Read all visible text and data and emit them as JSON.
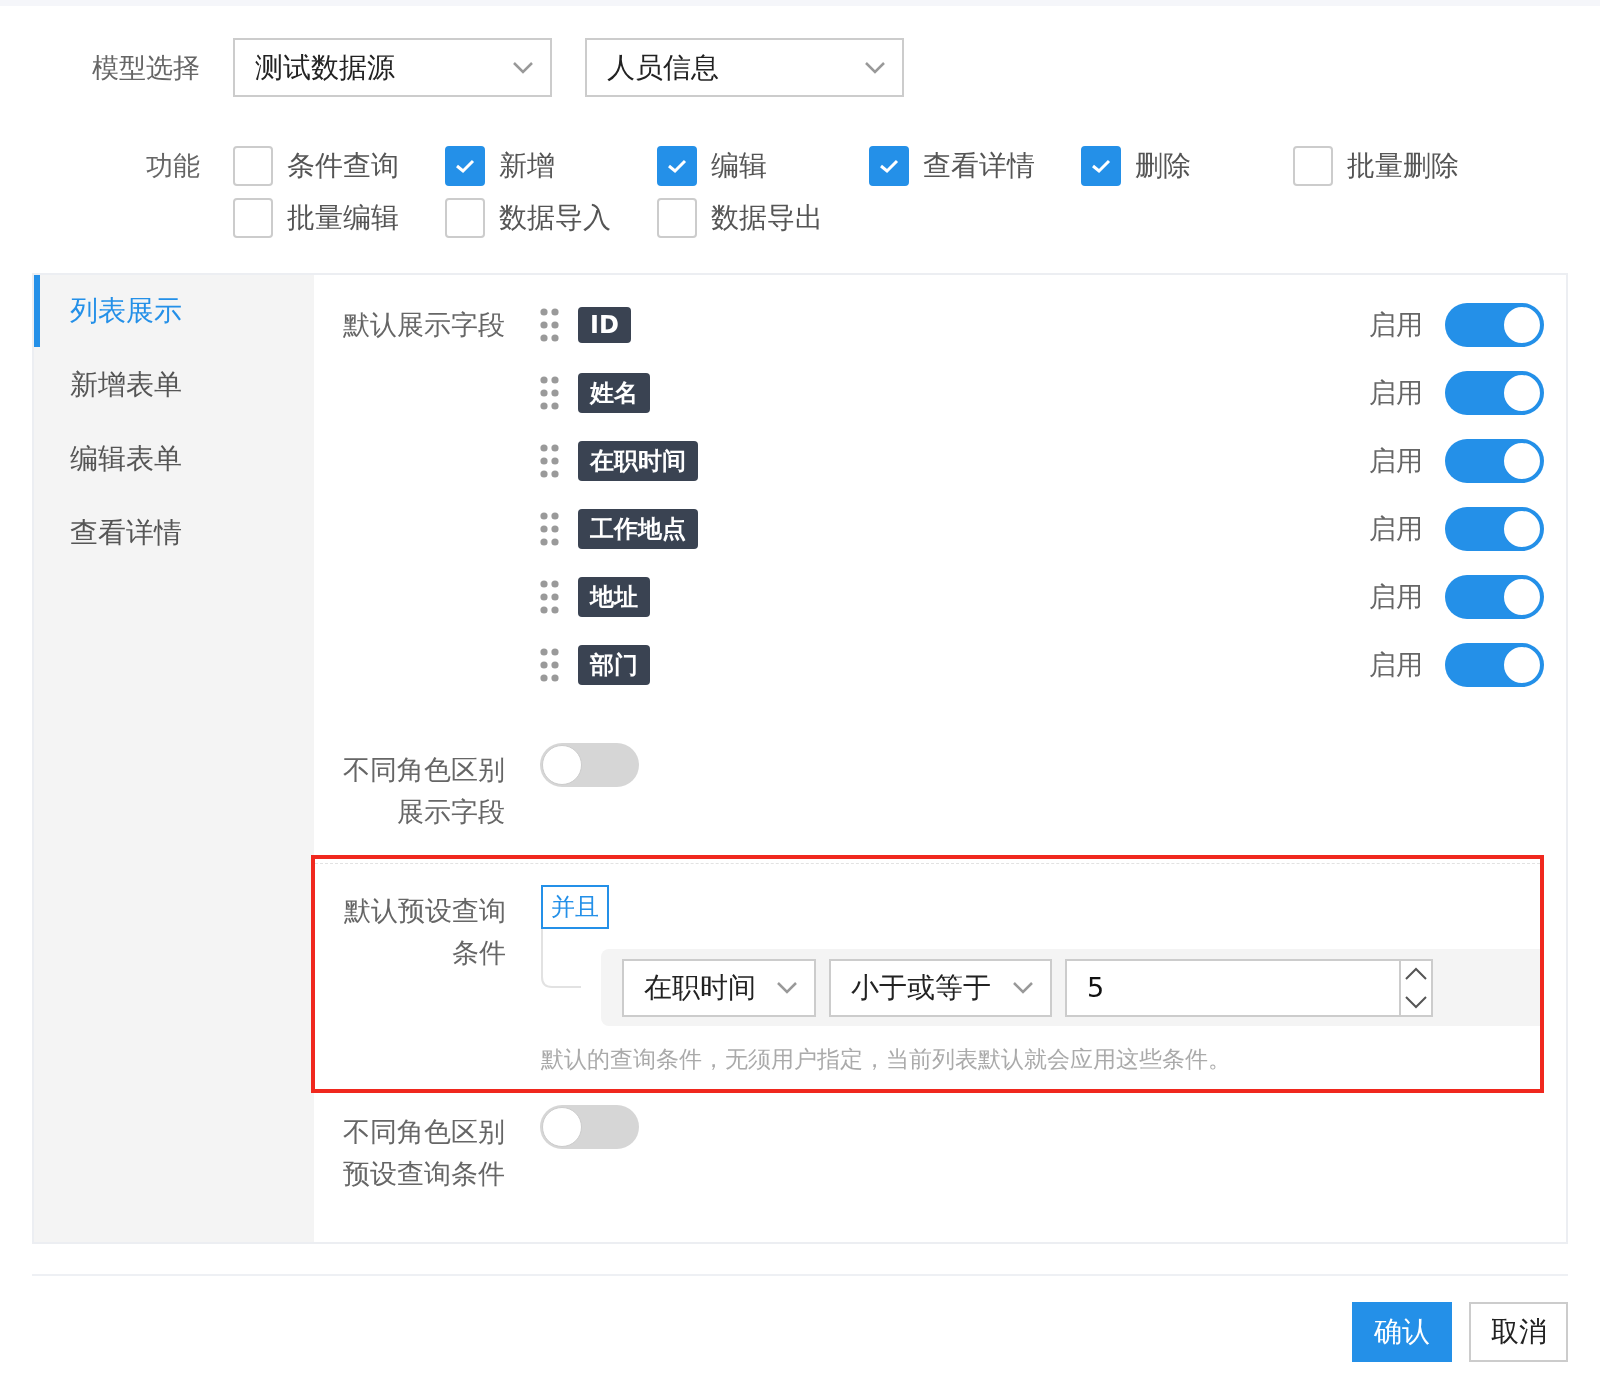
{
  "model_select": {
    "label": "模型选择",
    "selects": [
      {
        "value": "测试数据源"
      },
      {
        "value": "人员信息"
      }
    ]
  },
  "features": {
    "label": "功能",
    "options": [
      {
        "label": "条件查询",
        "checked": false
      },
      {
        "label": "新增",
        "checked": true
      },
      {
        "label": "编辑",
        "checked": true
      },
      {
        "label": "查看详情",
        "checked": true
      },
      {
        "label": "删除",
        "checked": true
      },
      {
        "label": "批量删除",
        "checked": false
      },
      {
        "label": "批量编辑",
        "checked": false
      },
      {
        "label": "数据导入",
        "checked": false
      },
      {
        "label": "数据导出",
        "checked": false
      }
    ]
  },
  "sidebar": {
    "items": [
      {
        "label": "列表展示",
        "selected": true
      },
      {
        "label": "新增表单",
        "selected": false
      },
      {
        "label": "编辑表单",
        "selected": false
      },
      {
        "label": "查看详情",
        "selected": false
      }
    ]
  },
  "default_fields": {
    "label": "默认展示字段",
    "fields": [
      {
        "name": "ID",
        "toggle_label": "启用",
        "on": true
      },
      {
        "name": "姓名",
        "toggle_label": "启用",
        "on": true
      },
      {
        "name": "在职时间",
        "toggle_label": "启用",
        "on": true
      },
      {
        "name": "工作地点",
        "toggle_label": "启用",
        "on": true
      },
      {
        "name": "地址",
        "toggle_label": "启用",
        "on": true
      },
      {
        "name": "部门",
        "toggle_label": "启用",
        "on": true
      }
    ]
  },
  "role_fields": {
    "label": "不同角色区别展示字段",
    "on": false
  },
  "query_conditions": {
    "label": "默认预设查询条件",
    "highlighted": true,
    "logic": "并且",
    "conditions": [
      {
        "field": "在职时间",
        "operator": "小于或等于",
        "value": "5"
      }
    ],
    "hint": "默认的查询条件，无须用户指定，当前列表默认就会应用这些条件。"
  },
  "role_conditions": {
    "label": "不同角色区别预设查询条件",
    "on": false
  },
  "buttons": [
    {
      "label": "确认",
      "kind": "primary"
    },
    {
      "label": "取消",
      "kind": "default"
    }
  ]
}
